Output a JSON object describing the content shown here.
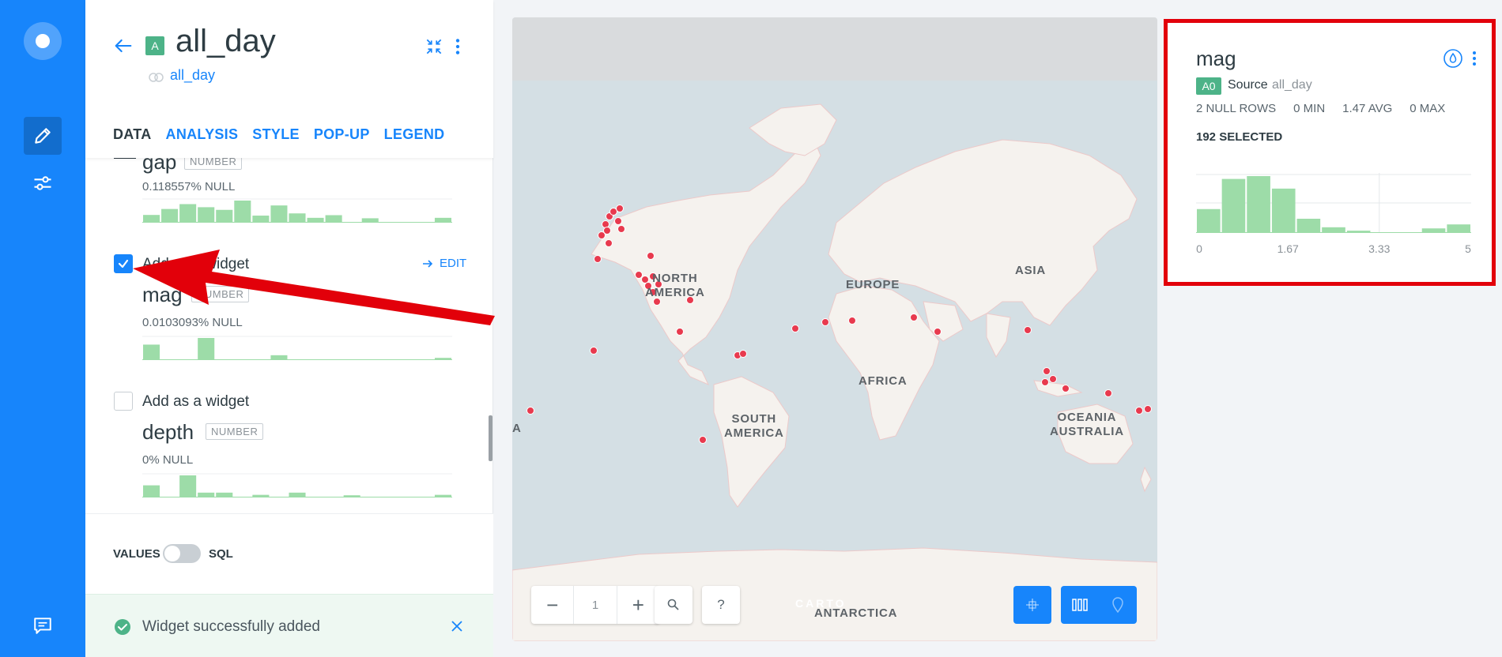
{
  "layer": {
    "letter": "A",
    "name": "all_day",
    "source": "all_day"
  },
  "tabs": [
    {
      "label": "DATA",
      "active": true
    },
    {
      "label": "ANALYSIS",
      "active": false
    },
    {
      "label": "STYLE",
      "active": false
    },
    {
      "label": "POP-UP",
      "active": false
    },
    {
      "label": "LEGEND",
      "active": false
    }
  ],
  "properties": [
    {
      "name": "gap",
      "type": "NUMBER",
      "null_text": "0.118557% NULL",
      "widget_checked": null,
      "histogram": [
        0.35,
        0.62,
        0.84,
        0.7,
        0.58,
        1.0,
        0.32,
        0.78,
        0.42,
        0.22,
        0.34,
        0.0,
        0.2,
        0.0,
        0.0,
        0.0,
        0.22
      ]
    },
    {
      "name": "mag",
      "type": "NUMBER",
      "null_text": "0.0103093% NULL",
      "widget_checked": true,
      "histogram": [
        0.7,
        0.0,
        0.0,
        1.0,
        0.0,
        0.0,
        0.0,
        0.22,
        0.0,
        0.0,
        0.0,
        0.0,
        0.0,
        0.0,
        0.0,
        0.0,
        0.1
      ]
    },
    {
      "name": "depth",
      "type": "NUMBER",
      "null_text": "0% NULL",
      "widget_checked": false,
      "histogram": [
        0.55,
        0.0,
        1.0,
        0.22,
        0.22,
        0.0,
        0.12,
        0.0,
        0.22,
        0.0,
        0.0,
        0.1,
        0.0,
        0.0,
        0.0,
        0.0,
        0.12
      ]
    }
  ],
  "widget_label": "Add as a widget",
  "edit_label": "EDIT",
  "footer": {
    "values_label": "VALUES",
    "sql_label": "SQL",
    "sql_mode": false
  },
  "toast": {
    "text": "Widget successfully added"
  },
  "map": {
    "labels": {
      "north_america": "NORTH\nAMERICA",
      "south_america": "SOUTH\nAMERICA",
      "europe": "EUROPE",
      "africa": "AFRICA",
      "asia": "ASIA",
      "oceania": "OCEANIA\nAUSTRALIA",
      "antarctica": "ANTARCTICA",
      "edge": "A"
    },
    "carto_mark": "CARTO",
    "zoom": {
      "minus": "−",
      "value": "1",
      "plus": "+"
    },
    "help": "?",
    "colors": {
      "ocean": "#d4dfe4",
      "land": "#f5f2ee",
      "point": "#e83a4e"
    }
  },
  "widget": {
    "title": "mag",
    "badge": "A0",
    "source_label": "Source",
    "source": "all_day",
    "stats": {
      "null_rows": "2 NULL ROWS",
      "min": "0 MIN",
      "avg": "1.47 AVG",
      "max": "0 MAX"
    },
    "selected": "192 SELECTED",
    "ticks": [
      {
        "value": 0,
        "label": "0"
      },
      {
        "value": 1.67,
        "label": "1.67"
      },
      {
        "value": 3.33,
        "label": "3.33"
      },
      {
        "value": 5,
        "label": "5"
      }
    ],
    "x_range": [
      0,
      5
    ],
    "histogram": [
      0.42,
      0.95,
      1.0,
      0.78,
      0.25,
      0.1,
      0.04,
      0.0,
      0.0,
      0.08,
      0.15
    ],
    "bar_color": "#9ddca8"
  },
  "colors": {
    "brand": "#1785fb",
    "highlight": "#e2000a",
    "layer": "#4db388"
  }
}
